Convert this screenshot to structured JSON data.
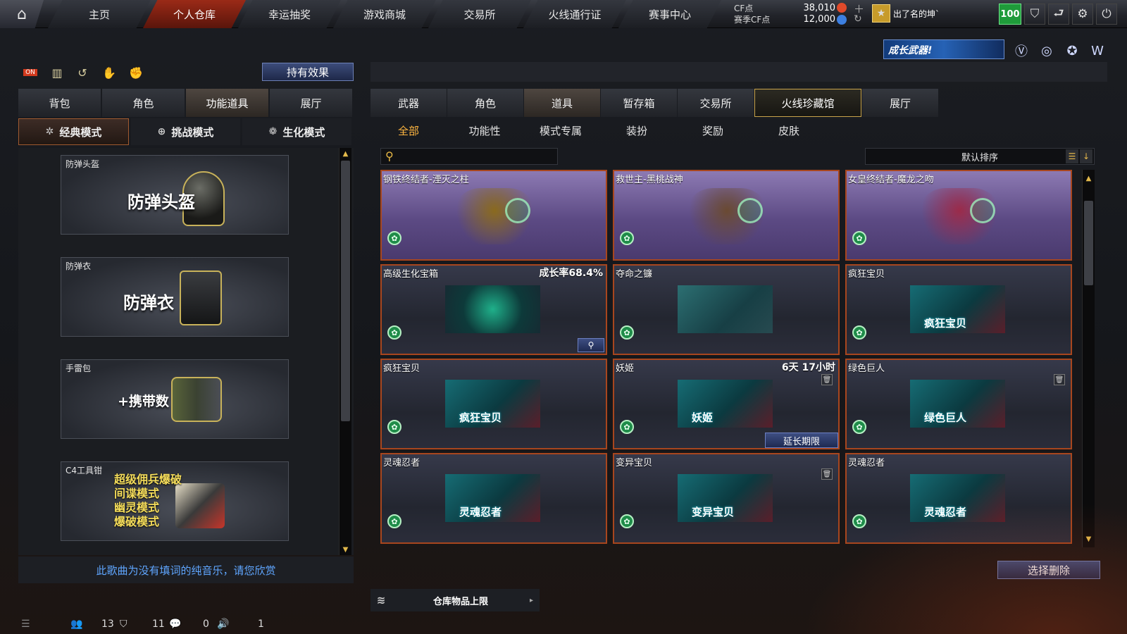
{
  "topnav": {
    "tabs": [
      "主页",
      "个人仓库",
      "幸运抽奖",
      "游戏商城",
      "交易所",
      "火线通行证",
      "赛事中心"
    ],
    "active_index": 1
  },
  "currency": {
    "cf_label": "CF点",
    "cf_value": "38,010",
    "event_label": "赛季CF点",
    "event_value": "12,000"
  },
  "user": {
    "name": "出了名的坤`",
    "level": "100"
  },
  "banner": {
    "text": "成长武器!"
  },
  "left": {
    "effect_button": "持有效果",
    "tabs": [
      "背包",
      "角色",
      "功能道具",
      "展厅"
    ],
    "active_tab": 2,
    "modes": [
      "经典模式",
      "挑战模式",
      "生化模式"
    ],
    "active_mode": 0,
    "cards": [
      {
        "caption": "防弹头盔",
        "big": "防弹头盔"
      },
      {
        "caption": "防弹衣",
        "big": "防弹衣"
      },
      {
        "caption": "手雷包",
        "big": "+携带数"
      },
      {
        "caption": "C4工具钳",
        "lines": [
          "超级佣兵爆破",
          "间谍模式",
          "幽灵模式",
          "爆破模式"
        ]
      }
    ],
    "music_text": "此歌曲为没有填词的纯音乐，请您欣赏"
  },
  "status": {
    "count1": "13",
    "count2": "11",
    "count3": "0",
    "count4": "1"
  },
  "right": {
    "category_tabs": [
      "武器",
      "角色",
      "道具",
      "暂存箱",
      "交易所",
      "火线珍藏馆",
      "展厅"
    ],
    "active_category": 2,
    "highlight_category": 5,
    "sub_tabs": [
      "全部",
      "功能性",
      "模式专属",
      "装扮",
      "奖励",
      "皮肤"
    ],
    "active_sub": 0,
    "sort_label": "默认排序",
    "search_placeholder": "",
    "items": [
      {
        "name": "钢铁终结者-湮灭之柱",
        "style": "purple",
        "hero": "#8a6a1e"
      },
      {
        "name": "救世主-黑桃战神",
        "style": "purple",
        "hero": "#6a4a32"
      },
      {
        "name": "女皇终结者-魔龙之吻",
        "style": "purple",
        "hero": "#9b2b4a"
      },
      {
        "name": "高级生化宝箱",
        "right": "成长率68.4%",
        "thumb": "box",
        "magnify": true
      },
      {
        "name": "夺命之镰",
        "thumb": "scythe"
      },
      {
        "name": "疯狂宝贝",
        "thumb": "char",
        "label": "疯狂宝贝"
      },
      {
        "name": "疯狂宝贝",
        "thumb": "char",
        "label": "疯狂宝贝"
      },
      {
        "name": "妖姬",
        "right": "6天 17小时",
        "thumb": "char",
        "label": "妖姬",
        "lock": true,
        "extend": "延长期限"
      },
      {
        "name": "绿色巨人",
        "thumb": "char",
        "label": "绿色巨人",
        "lock": true
      },
      {
        "name": "灵魂忍者",
        "thumb": "char",
        "label": "灵魂忍者"
      },
      {
        "name": "变异宝贝",
        "thumb": "char",
        "label": "变异宝贝",
        "lock": true
      },
      {
        "name": "灵魂忍者",
        "thumb": "char",
        "label": "灵魂忍者"
      }
    ],
    "delete_button": "选择删除",
    "capacity_label": "仓库物品上限"
  },
  "icons": {
    "home": "home-icon",
    "settings": "gear-icon",
    "power": "power-icon"
  }
}
